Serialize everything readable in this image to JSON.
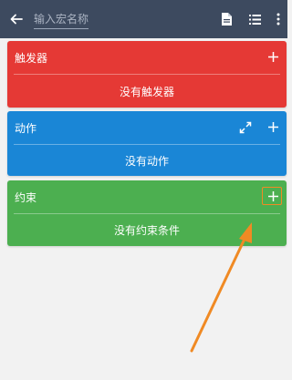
{
  "topbar": {
    "back_icon": "arrow-left-icon",
    "macro_name_placeholder": "输入宏名称",
    "icons": [
      "document-icon",
      "list-icon",
      "more-vert-icon"
    ]
  },
  "cards": {
    "triggers": {
      "title": "触发器",
      "empty_text": "没有触发器",
      "color": "#e53935"
    },
    "actions": {
      "title": "动作",
      "empty_text": "没有动作",
      "color": "#1a86d6"
    },
    "constraints": {
      "title": "约束",
      "empty_text": "没有约束条件",
      "color": "#4caf50"
    }
  },
  "annotation": {
    "color": "#f08a24"
  },
  "colors": {
    "topbar": "#3d4a5f",
    "background": "#f2f2f2"
  }
}
